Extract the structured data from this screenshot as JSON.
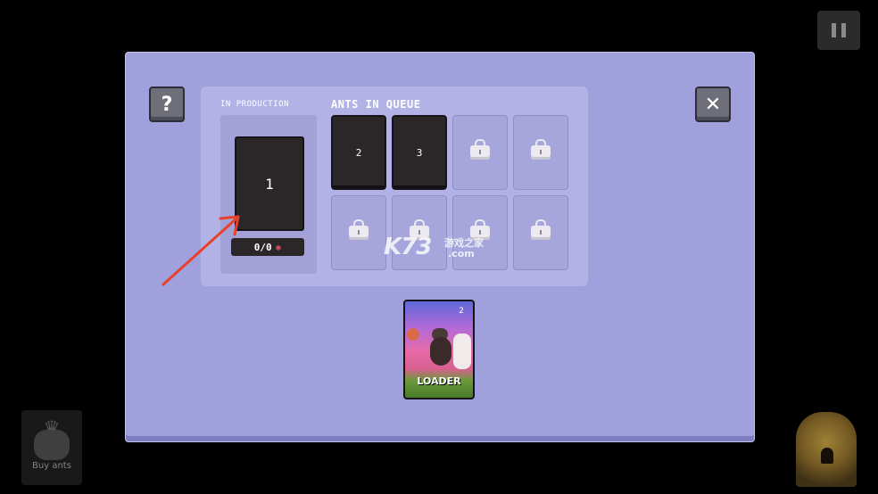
{
  "hud": {
    "pause_icon": "pause-icon"
  },
  "panel": {
    "help_icon": "question-mark-icon",
    "close_icon": "close-x-icon",
    "production": {
      "label": "IN PRODUCTION",
      "current_card": "1",
      "progress": "0/0",
      "progress_icon": "ant-icon"
    },
    "queue": {
      "label": "ANTS IN QUEUE",
      "slots": [
        {
          "state": "filled",
          "value": "2"
        },
        {
          "state": "filled",
          "value": "3"
        },
        {
          "state": "locked"
        },
        {
          "state": "locked"
        },
        {
          "state": "locked"
        },
        {
          "state": "locked"
        },
        {
          "state": "locked"
        },
        {
          "state": "locked"
        }
      ]
    },
    "card": {
      "name": "LOADER",
      "cost": "2"
    }
  },
  "watermark": {
    "main": "K73",
    "sub": "游戏之家",
    "sub2": ".com"
  },
  "bottom": {
    "buy_ants_label": "Buy ants",
    "buy_ants_icon": "crown-ant-icon",
    "nest_icon": "anthill-icon"
  },
  "colors": {
    "panel_bg": "#a0a0dc",
    "inner_bg": "#b2b2e6",
    "card_bg": "#2b2627",
    "arrow": "#e8402a"
  }
}
